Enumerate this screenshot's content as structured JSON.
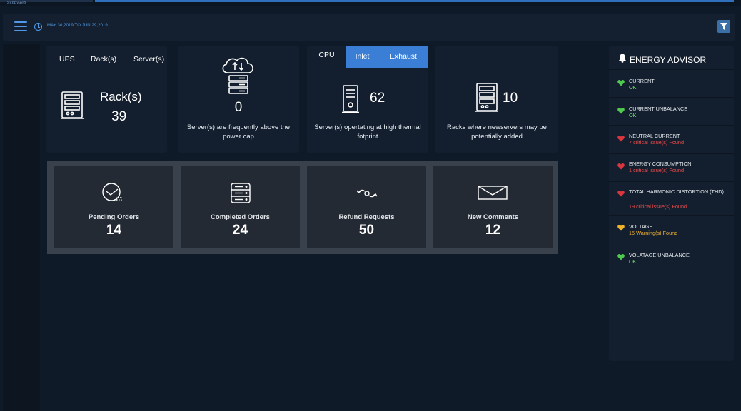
{
  "colors": {
    "accent": "#4f9ae8",
    "tab_active": "#3a7fd5",
    "ok": "#6ee06e",
    "critical": "#ef4b4b",
    "warning": "#f2b233",
    "heart_green": "#4ecb4e",
    "heart_red": "#d9363e",
    "heart_yellow": "#f0b429"
  },
  "brand": {
    "logo_text": "Sunbyweb"
  },
  "header": {
    "menu_icon": "hamburger-icon",
    "clock_icon": "clock-icon",
    "date_range": "MAY 30,2019 TO JUN 29,2019",
    "filter_icon": "filter-icon"
  },
  "ups_card": {
    "tabs": [
      "UPS",
      "Rack(s)",
      "Server(s)"
    ],
    "label": "Rack(s)",
    "value": "39"
  },
  "power_card": {
    "value": "0",
    "description": "Server(s) are frequently above the power cap"
  },
  "thermal_card": {
    "tabs": [
      "CPU",
      "Inlet",
      "Exhaust"
    ],
    "value": "62",
    "description": "Server(s) opertating at high thermal fotprint"
  },
  "newservers_card": {
    "value": "10",
    "description": "Racks where newservers may be potentially added"
  },
  "orders": [
    {
      "label": "Pending Orders",
      "value": "14",
      "icon": "clock-chart-icon"
    },
    {
      "label": "Completed Orders",
      "value": "24",
      "icon": "server-stack-icon"
    },
    {
      "label": "Refund Requests",
      "value": "50",
      "icon": "refresh-arrows-icon"
    },
    {
      "label": "New Comments",
      "value": "12",
      "icon": "envelope-icon"
    }
  ],
  "energy_advisor": {
    "title": "ENERGY ADVISOR",
    "items": [
      {
        "name": "CURRENT",
        "status": "OK",
        "level": "ok"
      },
      {
        "name": "CURRENT UNBALANCE",
        "status": "OK",
        "level": "ok"
      },
      {
        "name": "NEUTRAL CURRENT",
        "status": "7 critical issue(s) Found",
        "level": "critical"
      },
      {
        "name": "ENERGY CONSUMPTION",
        "status": "1 critical issue(s) Found",
        "level": "critical"
      },
      {
        "name": "TOTAL HARMONIC DISTORTION (THD)",
        "status": "19 critical issue(s) Found",
        "level": "critical"
      },
      {
        "name": "VOLTAGE",
        "status": "15 Warning(s) Found",
        "level": "warning"
      },
      {
        "name": "VOLATAGE UNBALANCE",
        "status": "OK",
        "level": "ok"
      }
    ]
  }
}
